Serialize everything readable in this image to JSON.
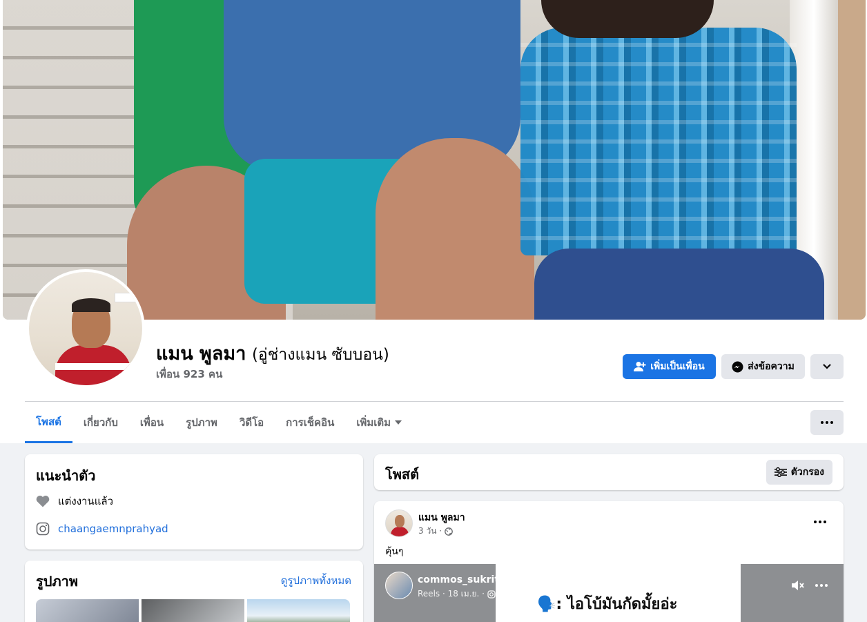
{
  "profile": {
    "name": "แมน พูลมา",
    "alternate_name": "(อู่ช่างแมน ซับบอน)",
    "friends_count": "เพื่อน 923 คน"
  },
  "actions": {
    "add_friend": "เพิ่มเป็นเพื่อน",
    "message": "ส่งข้อความ"
  },
  "tabs": [
    {
      "label": "โพสต์",
      "active": true
    },
    {
      "label": "เกี่ยวกับ"
    },
    {
      "label": "เพื่อน"
    },
    {
      "label": "รูปภาพ"
    },
    {
      "label": "วิดีโอ"
    },
    {
      "label": "การเช็คอิน"
    },
    {
      "label": "เพิ่มเติม"
    }
  ],
  "intro": {
    "title": "แนะนำตัว",
    "relationship": "แต่งงานแล้ว",
    "instagram": "chaangaemnprahyad"
  },
  "photos": {
    "title": "รูปภาพ",
    "see_all": "ดูรูปภาพทั้งหมด"
  },
  "posts": {
    "title": "โพสต์",
    "filter_label": "ตัวกรอง"
  },
  "post": {
    "author": "แมน พูลมา",
    "time": "3 วัน ·",
    "text": "คุ้นๆ",
    "reel": {
      "author": "commos_sukrit",
      "meta": "Reels · 18 เม.ย. ·",
      "caption": "🗣️: ไอโบ้มันกัดมั้ยอ่ะ"
    }
  },
  "colors": {
    "accent": "#1b74e4",
    "page_bg": "#f0f2f5",
    "link": "#216fdb"
  }
}
